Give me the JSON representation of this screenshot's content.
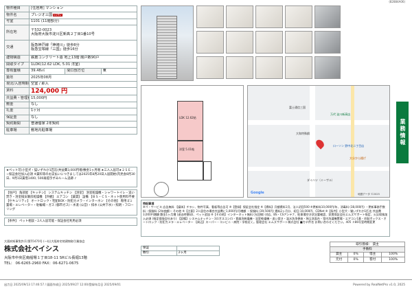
{
  "doc_no": "(82884A06)",
  "spec": [
    {
      "k": "物件種目",
      "v": "[住居用] マンション"
    },
    {
      "k": "物件名",
      "v": "プレジオ三国",
      "badge": "EURO"
    },
    {
      "k": "号室",
      "v": "1101 (11階部分)"
    },
    {
      "k": "所在地",
      "v": "〒532-0023\n大阪府大阪市淀川区新高２丁目1番10号"
    },
    {
      "k": "交通",
      "v": "阪急神戸線「神崎川」徒歩8分\n阪急宝塚線「三国」徒歩16分"
    },
    {
      "k": "建物構造",
      "v": "鉄筋コンクリート造 地上13階 館戸数90戸"
    },
    {
      "k": "間取タイプ",
      "v": "1LDK(12.62 LDK, 5.01 洋室)"
    },
    {
      "k": "専有面積",
      "v": "39.48㎡",
      "k2": "間口部方位",
      "v2": "東"
    },
    {
      "k": "築年",
      "v": "2025年08月"
    },
    {
      "k": "現況/入居時期",
      "v": "空室 / 即入",
      "status": "空室"
    },
    {
      "k": "賃料",
      "v": "124,000 円",
      "rent": true
    },
    {
      "k": "共益費・管理費",
      "v": "15,000円"
    },
    {
      "k": "敷金",
      "v": "なし"
    },
    {
      "k": "礼金",
      "v": "1ヶ月"
    },
    {
      "k": "保証金",
      "v": "なし"
    },
    {
      "k": "契約期間",
      "v": "普通借家 2年契約"
    },
    {
      "k": "駐車場",
      "v": "敷地内駐車場"
    }
  ],
  "note1": "★ペット可(小型犬・猫いずれか1匹迄(共益費3,000円増)敷金1ヶ月増 ★三人入居可★２ＳＥ.. ☆保証会社加入必須 ※賃料等のお支払いにつきましては2025年8月20日入居開始(内見会8月30日、9月1日賃借1400, 500再提示ずみルーム追跡 ♪",
  "note2": "【住戸】 角部屋 【キッチン】 システムキッチン 【浴室】 浴室乾燥機・シャワートイレ・追い焚き・浴室換気暖房乾燥機 【外観】 エアコン 【賃貸】 設備 【ＢＳ・ＣＳ・ネット使用料不要 【セキュリティ】 オートロック・宅配BOX・防犯カメラ・インターホン 【その他】 専用ゴミ置場・エレベーター・駐輪場・ガス (都市ガス)・水道 (公営)・排水 (公共下水)・照明・フローリング",
  "note3": "【条件】 ペット相談・2人入居可能・保証会社利用必須",
  "remarks_title": "特記事項",
  "remarks": "※ペ・サービス 広告無料 【媒体】チラシ、物件写真、看板等広告可 ※【登録】保証会社指定 ※【賃料】月額賃料1月、法人初回500 ※更新料10,000円/年、消毒料 (38,000円) ・更新事務手数料・保険料 (2年度額)・その他 ※【注意】2人居住の場合共益費に1,000円/月増額 ・保険料 (39,500円) 賃料2ヶ月分、初回 10,000円、CDNet ※【条件】小型犬・猫いずれか1匹迄 共益費3,000円増額 敷金1ヶ月増 (退去時償却)、ペット追加 ※【その他】インターネット無料 (光回線) 対応、BS・CSアンテナ、駐車場空き状況要確認、家賃保証会社エムズサポート指定、火災保険加入必須 (指定保険会社あり) 【設備】システムキッチン・3口ガスコンロ・食器洗乾燥機・浴室乾燥機・追い焚き・温水洗浄便座・独立洗面台・室内洗濯機置場・エアコン1基・宅配ボックス・オートロック・防犯カメラ・エレベーター 【周辺】スーパー・コンビニ・病院・学校近く。管理会社 エムズサポート株式会社 ■カテ件名 お問い合わせください。405 ３86号室時期変更",
  "move": {
    "k1": "保証",
    "v1": "",
    "k2": "敷引",
    "v2": "2ヶ月"
  },
  "license": "大阪府知事免許(1)第55470号 (一社)大阪府宅地建物取引業協会",
  "company": "株式会社ベイシス",
  "address": "大阪市中央区南船場１丁目18-11 SRビル長堀13階",
  "tel": "TEL： 06-6265-2960  FAX：06-6271-0675",
  "deal": {
    "head1": "取引態様： 貸主",
    "head2": "手数料",
    "rows": [
      [
        "貸主",
        "0%",
        "借主",
        "100%"
      ],
      [
        "元付",
        "0%",
        "客付",
        "100%"
      ]
    ]
  },
  "sidetab": "業務情報",
  "map": {
    "labels": [
      "富士通信三国",
      "万代 淀川新高店",
      "大和特殊鋼",
      "ローソン 野中北二丁目店",
      "大分から揚げ",
      "ダイハツ（ミーザル）",
      "Google",
      "地図データ ©2025"
    ]
  },
  "plan": {
    "ldk": "LDK 12.62帖",
    "room": "洋室 5.01帖"
  },
  "print_info": "出力日 2025/09/13 17:46:57 / 図面作成日 2025/09/27 12:00/登録年月日 2025/09/01",
  "rea": "Powered by RealNetPro v1.0, 2025"
}
